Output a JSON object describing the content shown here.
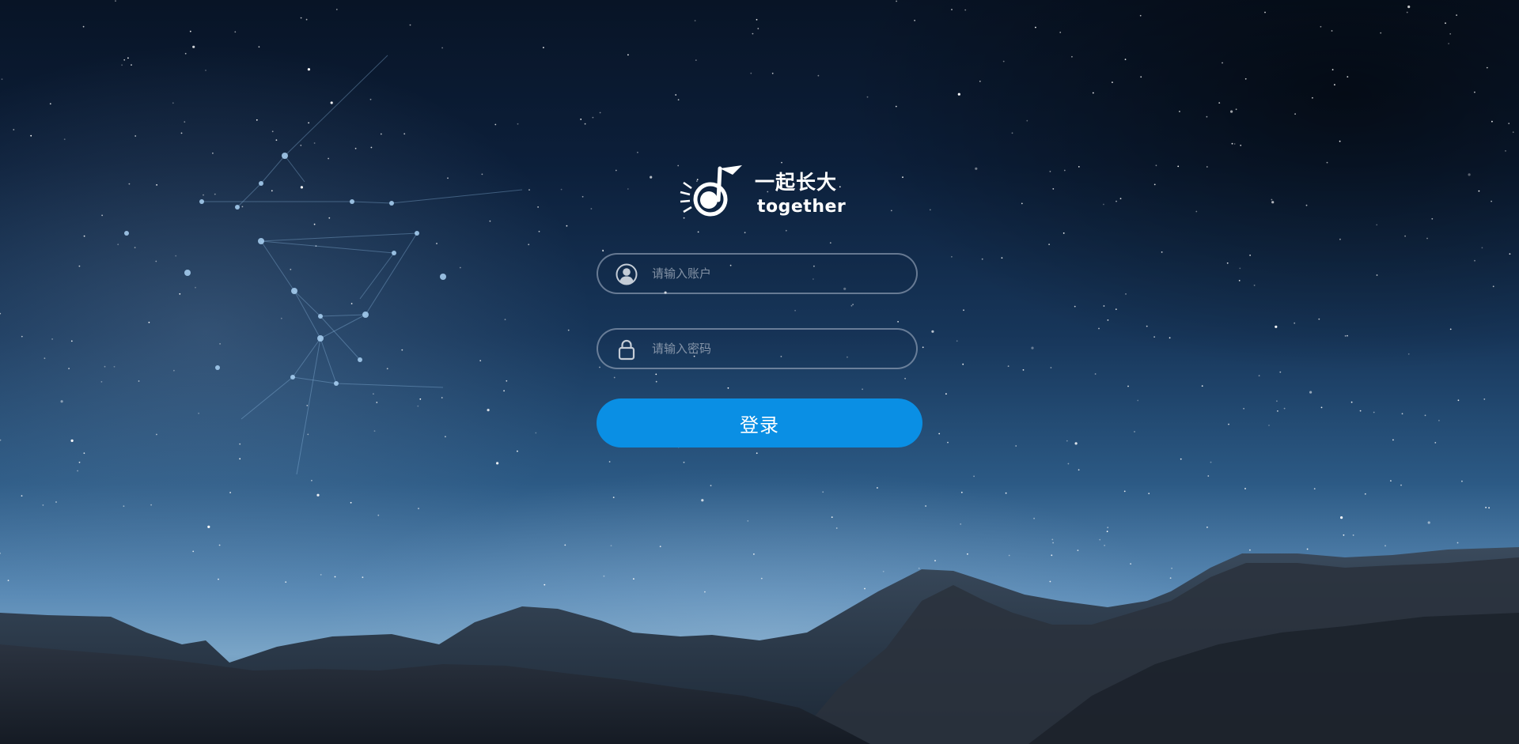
{
  "logo": {
    "cn_text": "一起长大",
    "en_text": "together"
  },
  "login_form": {
    "username_placeholder": "请输入账户",
    "password_placeholder": "请输入密码",
    "submit_label": "登录"
  },
  "colors": {
    "button": "#0a8fe4",
    "field_border": "#a0afc3"
  },
  "icons": {
    "username": "user-avatar-icon",
    "password": "lock-icon"
  }
}
